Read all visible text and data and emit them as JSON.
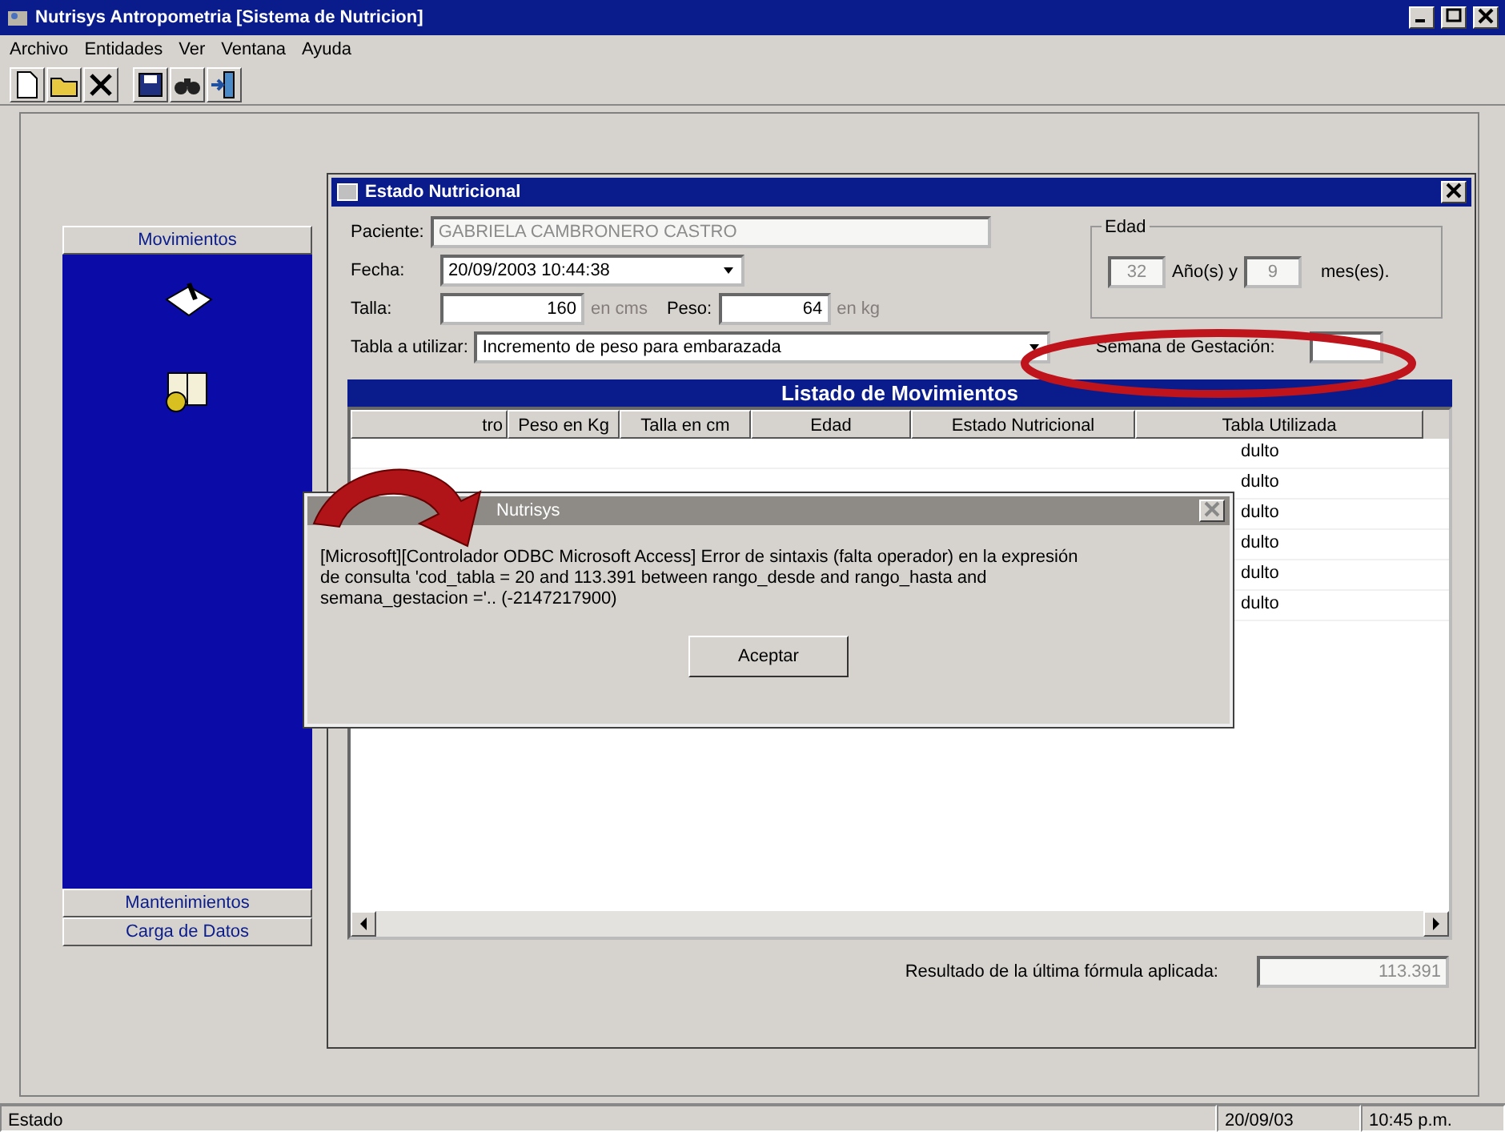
{
  "window": {
    "title": "Nutrisys Antropometria [Sistema de Nutricion]"
  },
  "menu": [
    {
      "label": "Archivo"
    },
    {
      "label": "Entidades"
    },
    {
      "label": "Ver"
    },
    {
      "label": "Ventana"
    },
    {
      "label": "Ayuda"
    }
  ],
  "toolbar": [
    {
      "kind": "new"
    },
    {
      "kind": "open"
    },
    {
      "kind": "delete"
    },
    {
      "kind": "save"
    },
    {
      "kind": "find"
    },
    {
      "kind": "exit"
    }
  ],
  "sidebar": {
    "sections": [
      {
        "label": "Movimientos",
        "expanded": true,
        "items": [
          {
            "kind": "scale"
          },
          {
            "kind": "book"
          }
        ]
      },
      {
        "label": "Mantenimientos",
        "expanded": false
      },
      {
        "label": "Carga de Datos",
        "expanded": false
      }
    ]
  },
  "child_window": {
    "title": "Estado Nutricional",
    "paciente": {
      "label": "Paciente:",
      "value": "GABRIELA CAMBRONERO CASTRO",
      "disabled": true
    },
    "fecha": {
      "label": "Fecha:",
      "value": "20/09/2003 10:44:38"
    },
    "talla": {
      "label": "Talla:",
      "value": "160",
      "unit": "en cms"
    },
    "peso": {
      "label": "Peso:",
      "value": "64",
      "unit": "en kg"
    },
    "tabla": {
      "label": "Tabla a utilizar:",
      "value": "Incremento de peso para embarazada"
    },
    "edad": {
      "legend": "Edad",
      "years": "32",
      "years_label": "Año(s) y",
      "months": "9",
      "months_label": "mes(es)."
    },
    "semana": {
      "label": "Semana de Gestación:"
    },
    "listado": {
      "title": "Listado de Movimientos",
      "columns": [
        "tro",
        "Peso en Kg",
        "Talla en cm",
        "Edad",
        "Estado Nutricional",
        "Tabla Utilizada"
      ],
      "rows": [
        {
          "tabla": "dulto"
        },
        {
          "tabla": "dulto"
        },
        {
          "tabla": "dulto"
        },
        {
          "tabla": "dulto"
        },
        {
          "tabla": "dulto"
        },
        {
          "tabla": "dulto"
        }
      ]
    },
    "result": {
      "label": "Resultado de la última fórmula aplicada:",
      "value": "113.391"
    }
  },
  "dialog": {
    "title": "Nutrisys",
    "message": "[Microsoft][Controlador ODBC Microsoft Access] Error de sintaxis (falta operador) en la expresión\nde consulta 'cod_tabla = 20 and 113.391 between rango_desde and rango_hasta and\nsemana_gestacion ='.. (-2147217900)",
    "button": "Aceptar"
  },
  "annotations": [
    {
      "kind": "ellipse",
      "color": "#c0141c"
    },
    {
      "kind": "arrow",
      "color": "#b01418"
    }
  ],
  "status_bar": [
    "Estado",
    "20/09/03",
    "10:45 p.m."
  ]
}
